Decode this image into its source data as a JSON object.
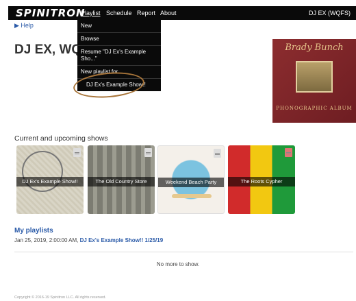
{
  "brand": "SPINITRON",
  "nav": {
    "items": [
      "Playlist",
      "Schedule",
      "Report",
      "About"
    ],
    "user": "DJ EX (WQFS)"
  },
  "help": "▶ Help",
  "page_title": "DJ EX, WQFS",
  "dropdown": {
    "items": [
      "New",
      "Browse",
      "Resume \"DJ Ex's Example Sho...\"",
      "New playlist for...",
      "DJ Ex's Example Show!!"
    ]
  },
  "album": {
    "title": "Brady Bunch",
    "subtitle": "PHONOGRAPHIC ALBUM"
  },
  "section_title": "Current and upcoming shows",
  "shows": [
    "DJ Ex's Example Show!!",
    "The Old Country Store",
    "Weekend Beach Party",
    "The Roots Cypher"
  ],
  "my_playlists": {
    "heading": "My playlists",
    "date": "Jan 25, 2019, 2:00:00 AM,",
    "link": "DJ Ex's Example Show!! 1/25/19"
  },
  "no_more": "No more to show.",
  "copyright": "Copyright © 2016-19 Spinitron LLC. All rights reserved.",
  "colors": {
    "nav_bg": "#0a0a0a",
    "link": "#2a5aa8",
    "annotation": "#a8753a"
  }
}
